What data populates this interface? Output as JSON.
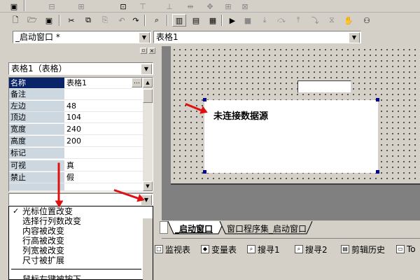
{
  "toolbar_top": {
    "icons": [
      "form-icon",
      "align-left-icon",
      "align-center-icon",
      "align-right-icon",
      "distribute-icon",
      "space-icon",
      "spacing-icon",
      "move-icon"
    ]
  },
  "toolbar_main": {
    "icons": [
      "new-icon",
      "open-icon",
      "save-icon",
      "cut-icon",
      "copy-icon",
      "paste-icon",
      "undo-icon",
      "redo-icon",
      "find-icon",
      "layout1-icon",
      "layout2-icon",
      "layout3-icon",
      "run-icon",
      "stop-icon",
      "step-into-icon",
      "step-over-icon",
      "step-out-icon",
      "breakpoint-icon",
      "hand-icon",
      "binoculars-icon"
    ]
  },
  "selector": {
    "window_combo": "_启动窗口 *",
    "control_combo": "表格1"
  },
  "props_panel": {
    "object_combo": "表格1（表格）",
    "rows": [
      {
        "name": "名称",
        "value": "表格1",
        "selected": true
      },
      {
        "name": "备注",
        "value": ""
      },
      {
        "name": "左边",
        "value": "48"
      },
      {
        "name": "顶边",
        "value": "104"
      },
      {
        "name": "宽度",
        "value": "240"
      },
      {
        "name": "高度",
        "value": "200"
      },
      {
        "name": "标记",
        "value": ""
      },
      {
        "name": "可视",
        "value": "真"
      },
      {
        "name": "禁止",
        "value": "假"
      }
    ],
    "event_combo": "",
    "events": [
      "光标位置改变",
      "选择行列数改变",
      "内容被改变",
      "行高被改变",
      "列宽被改变",
      "尺寸被扩展"
    ],
    "events_more": "鼠标左键被按下"
  },
  "canvas": {
    "table_text": "未连接数据源"
  },
  "tabs": {
    "items": [
      "_启动窗口",
      "窗口程序集_启动窗口"
    ]
  },
  "bottom_bar": {
    "items": [
      "监视表",
      "变量表",
      "搜寻1",
      "搜寻2",
      "剪辑历史",
      "To"
    ]
  },
  "colors": {
    "accent_arrow": "#e01010",
    "selection": "#0a246a",
    "prop_name_bg": "#ccd7e0",
    "handle": "#00008b"
  }
}
